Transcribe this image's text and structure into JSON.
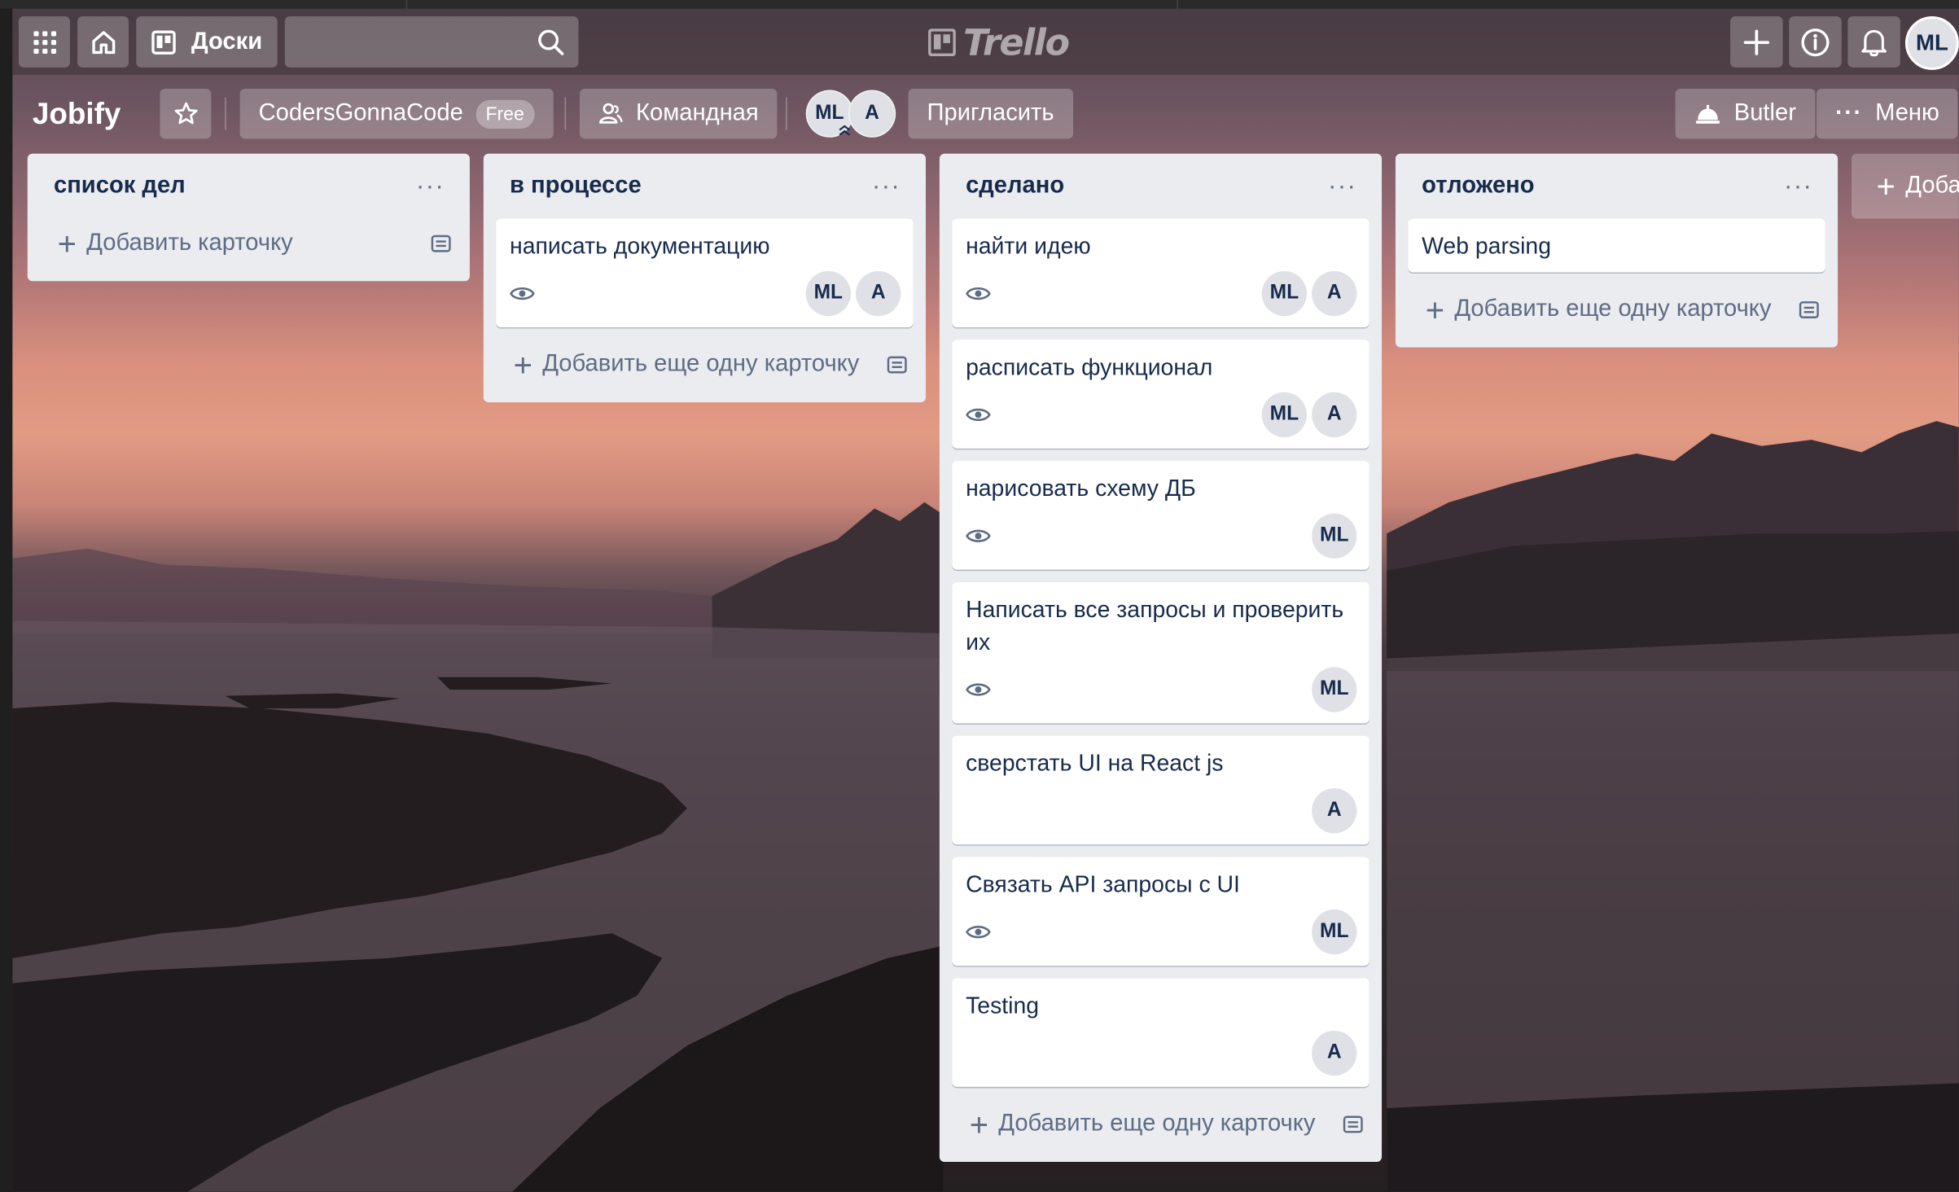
{
  "header": {
    "boards_label": "Доски",
    "search_placeholder": "",
    "logo_text": "Trello",
    "me_initials": "ML"
  },
  "board": {
    "title": "Jobify",
    "team": "CodersGonnaCode",
    "team_badge": "Free",
    "visibility": "Командная",
    "members": [
      "ML",
      "A"
    ],
    "invite_label": "Пригласить",
    "butler_label": "Butler",
    "menu_label": "Меню",
    "add_list_label": "Доба"
  },
  "lists": [
    {
      "title": "список дел",
      "cards": [],
      "add_label": "Добавить карточку"
    },
    {
      "title": "в процессе",
      "cards": [
        {
          "title": "написать документацию",
          "watch": true,
          "members": [
            "ML",
            "A"
          ]
        }
      ],
      "add_label": "Добавить еще одну карточку"
    },
    {
      "title": "сделано",
      "cards": [
        {
          "title": "найти идею",
          "watch": true,
          "members": [
            "ML",
            "A"
          ]
        },
        {
          "title": "расписать функционал",
          "watch": true,
          "members": [
            "ML",
            "A"
          ]
        },
        {
          "title": "нарисовать схему ДБ",
          "watch": true,
          "members": [
            "ML"
          ]
        },
        {
          "title": "Написать все запросы и проверить их",
          "watch": true,
          "members": [
            "ML"
          ]
        },
        {
          "title": "сверстать UI на React js",
          "watch": false,
          "members": [
            "A"
          ]
        },
        {
          "title": "Связать API запросы с UI",
          "watch": true,
          "members": [
            "ML"
          ]
        },
        {
          "title": "Testing",
          "watch": false,
          "members": [
            "A"
          ]
        }
      ],
      "add_label": "Добавить еще одну карточку"
    },
    {
      "title": "отложено",
      "cards": [
        {
          "title": "Web parsing",
          "watch": false,
          "members": []
        }
      ],
      "add_label": "Добавить еще одну карточку"
    }
  ],
  "colors": {
    "list_bg": "#ebecf0",
    "card_bg": "#ffffff",
    "text": "#172b4d",
    "muted": "#5e6c84"
  }
}
